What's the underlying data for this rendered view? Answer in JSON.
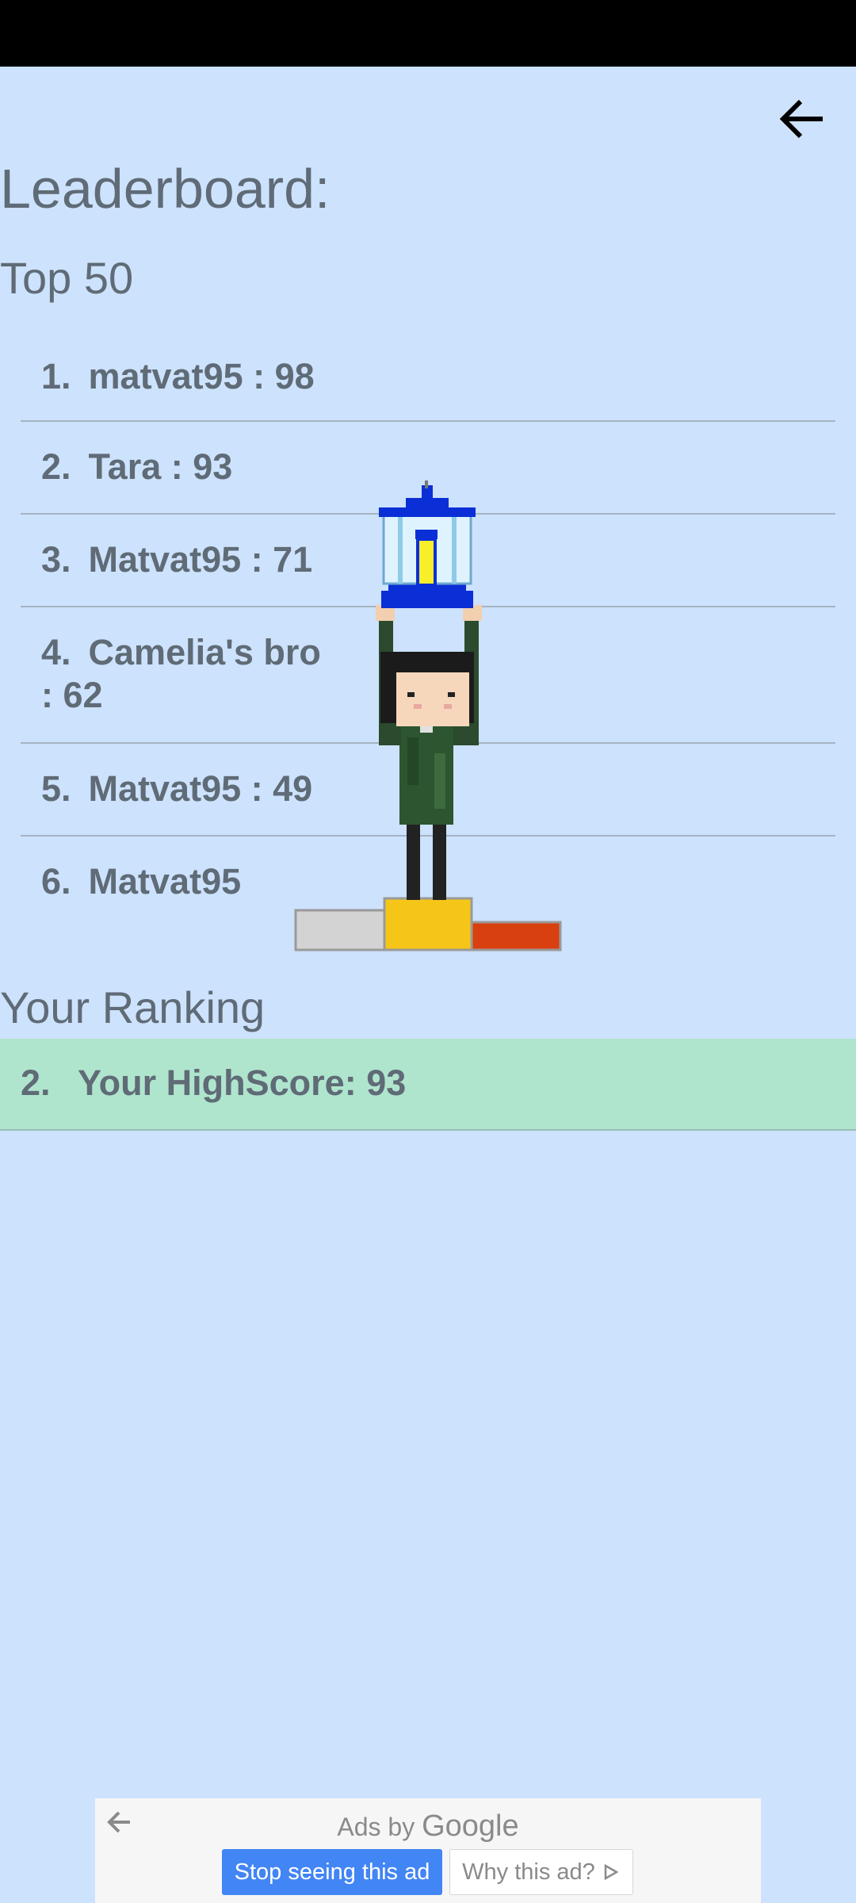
{
  "header": {
    "title": "Leaderboard:",
    "subtitle": "Top 50"
  },
  "leaderboard": [
    {
      "rank": "1.",
      "entry": "matvat95 : 98"
    },
    {
      "rank": "2.",
      "entry": "Tara : 93"
    },
    {
      "rank": "3.",
      "entry": "Matvat95 : 71"
    },
    {
      "rank": "4.",
      "entry": "Camelia's bro : 62"
    },
    {
      "rank": "5.",
      "entry": "Matvat95 : 49"
    },
    {
      "rank": "6.",
      "entry": "Matvat95"
    }
  ],
  "your_ranking": {
    "title": "Your Ranking",
    "rank": "2.",
    "label": "Your HighScore: 93"
  },
  "ad": {
    "ads_by": "Ads by",
    "brand": "Google",
    "stop": "Stop seeing this ad",
    "why": "Why this ad?"
  },
  "colors": {
    "background": "#cde2fc",
    "highlight": "#b0e5cd",
    "text": "#5f6b76",
    "ad_button": "#4285f4"
  }
}
